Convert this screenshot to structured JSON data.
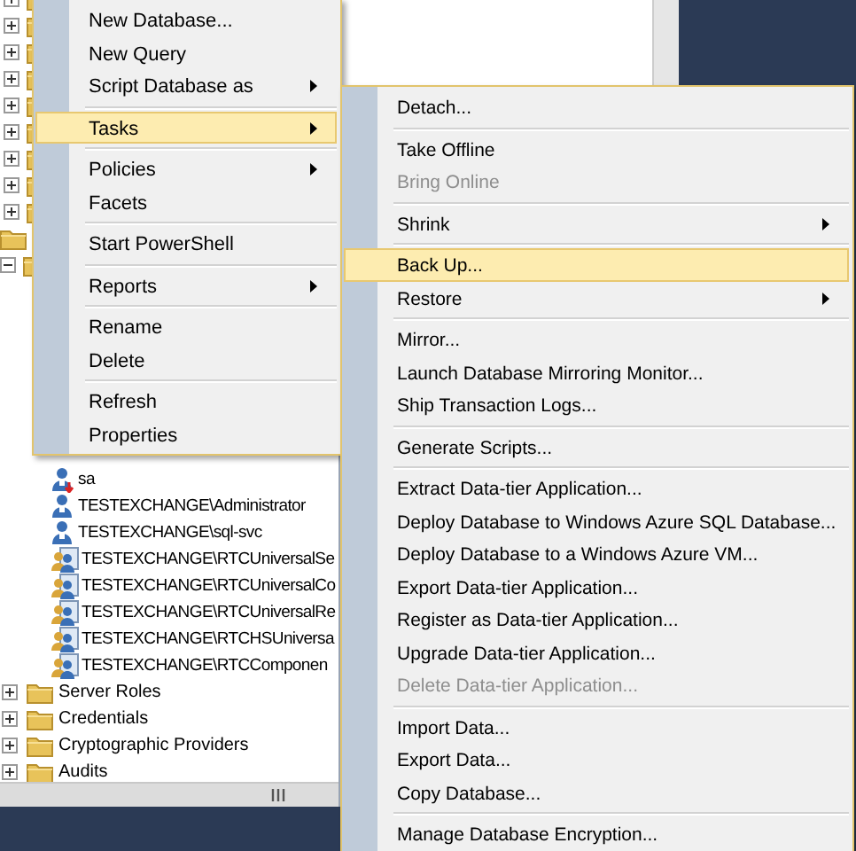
{
  "tree": {
    "top_rows": [
      {
        "expanded": false
      },
      {
        "expanded": false
      },
      {
        "expanded": false
      },
      {
        "expanded": false
      },
      {
        "expanded": false
      },
      {
        "expanded": false
      },
      {
        "expanded": false
      },
      {
        "expanded": false
      },
      {
        "expanded": false
      },
      {
        "kind": "leaf"
      },
      {
        "expanded": true
      }
    ],
    "logins": [
      {
        "kind": "user_denied",
        "label": "sa"
      },
      {
        "kind": "user",
        "label": "TESTEXCHANGE\\Administrator"
      },
      {
        "kind": "user",
        "label": "TESTEXCHANGE\\sql-svc"
      },
      {
        "kind": "group",
        "label": "TESTEXCHANGE\\RTCUniversalSe"
      },
      {
        "kind": "group",
        "label": "TESTEXCHANGE\\RTCUniversalCo"
      },
      {
        "kind": "group",
        "label": "TESTEXCHANGE\\RTCUniversalRe"
      },
      {
        "kind": "group",
        "label": "TESTEXCHANGE\\RTCHSUniversa"
      },
      {
        "kind": "group",
        "label": "TESTEXCHANGE\\RTCComponen"
      }
    ],
    "folders": [
      {
        "expanded": false,
        "label": "Server Roles"
      },
      {
        "expanded": false,
        "label": "Credentials"
      },
      {
        "expanded": false,
        "label": "Cryptographic Providers"
      },
      {
        "expanded": false,
        "label": "Audits"
      }
    ]
  },
  "context_menu": {
    "groups": [
      [
        {
          "label": "New Database...",
          "submenu": false,
          "selected": false
        },
        {
          "label": "New Query",
          "submenu": false,
          "selected": false
        },
        {
          "label": "Script Database as",
          "submenu": true,
          "selected": false
        }
      ],
      [
        {
          "label": "Tasks",
          "submenu": true,
          "selected": true
        }
      ],
      [
        {
          "label": "Policies",
          "submenu": true,
          "selected": false
        },
        {
          "label": "Facets",
          "submenu": false,
          "selected": false
        }
      ],
      [
        {
          "label": "Start PowerShell",
          "submenu": false,
          "selected": false
        }
      ],
      [
        {
          "label": "Reports",
          "submenu": true,
          "selected": false
        }
      ],
      [
        {
          "label": "Rename",
          "submenu": false,
          "selected": false
        },
        {
          "label": "Delete",
          "submenu": false,
          "selected": false
        }
      ],
      [
        {
          "label": "Refresh",
          "submenu": false,
          "selected": false
        },
        {
          "label": "Properties",
          "submenu": false,
          "selected": false
        }
      ]
    ]
  },
  "tasks_submenu": {
    "groups": [
      [
        {
          "label": "Detach...",
          "submenu": false,
          "selected": false,
          "disabled": false
        }
      ],
      [
        {
          "label": "Take Offline",
          "submenu": false,
          "selected": false,
          "disabled": false
        },
        {
          "label": "Bring Online",
          "submenu": false,
          "selected": false,
          "disabled": true
        }
      ],
      [
        {
          "label": "Shrink",
          "submenu": true,
          "selected": false,
          "disabled": false
        }
      ],
      [
        {
          "label": "Back Up...",
          "submenu": false,
          "selected": true,
          "disabled": false
        },
        {
          "label": "Restore",
          "submenu": true,
          "selected": false,
          "disabled": false
        }
      ],
      [
        {
          "label": "Mirror...",
          "submenu": false,
          "selected": false,
          "disabled": false
        },
        {
          "label": "Launch Database Mirroring Monitor...",
          "submenu": false,
          "selected": false,
          "disabled": false
        },
        {
          "label": "Ship Transaction Logs...",
          "submenu": false,
          "selected": false,
          "disabled": false
        }
      ],
      [
        {
          "label": "Generate Scripts...",
          "submenu": false,
          "selected": false,
          "disabled": false
        }
      ],
      [
        {
          "label": "Extract Data-tier Application...",
          "submenu": false,
          "selected": false,
          "disabled": false
        },
        {
          "label": "Deploy Database to Windows Azure SQL Database...",
          "submenu": false,
          "selected": false,
          "disabled": false
        },
        {
          "label": "Deploy Database to a Windows Azure VM...",
          "submenu": false,
          "selected": false,
          "disabled": false
        },
        {
          "label": "Export Data-tier Application...",
          "submenu": false,
          "selected": false,
          "disabled": false
        },
        {
          "label": "Register as Data-tier Application...",
          "submenu": false,
          "selected": false,
          "disabled": false
        },
        {
          "label": "Upgrade Data-tier Application...",
          "submenu": false,
          "selected": false,
          "disabled": false
        },
        {
          "label": "Delete Data-tier Application...",
          "submenu": false,
          "selected": false,
          "disabled": true
        }
      ],
      [
        {
          "label": "Import Data...",
          "submenu": false,
          "selected": false,
          "disabled": false
        },
        {
          "label": "Export Data...",
          "submenu": false,
          "selected": false,
          "disabled": false
        },
        {
          "label": "Copy Database...",
          "submenu": false,
          "selected": false,
          "disabled": false
        }
      ],
      [
        {
          "label": "Manage Database Encryption...",
          "submenu": false,
          "selected": false,
          "disabled": false
        }
      ]
    ]
  }
}
